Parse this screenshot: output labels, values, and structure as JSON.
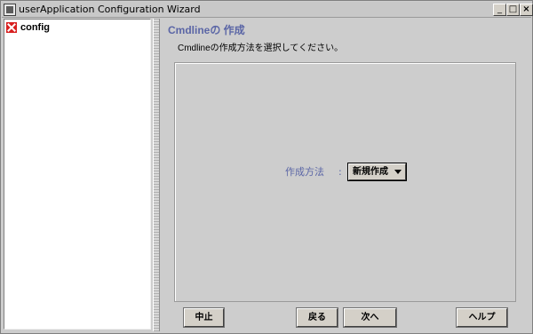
{
  "window": {
    "title": "userApplication Configuration Wizard",
    "controls": {
      "minimize": "_",
      "maximize": "□",
      "close": "×"
    }
  },
  "tree": {
    "items": [
      {
        "label": "config",
        "icon": "config-node-icon"
      }
    ]
  },
  "content": {
    "heading": "Cmdlineの 作成",
    "instruction": "Cmdlineの作成方法を選択してください。",
    "method": {
      "label": "作成方法",
      "colon": ":",
      "selected": "新規作成"
    }
  },
  "buttons": {
    "cancel": "中止",
    "back": "戻る",
    "next": "次へ",
    "help": "ヘルプ"
  },
  "colors": {
    "accent_text": "#5b66a6",
    "tree_icon": "#d82020",
    "panel_background": "#cdcdcd"
  }
}
